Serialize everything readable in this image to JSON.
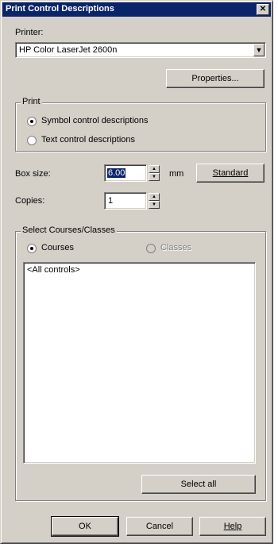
{
  "window": {
    "title": "Print Control Descriptions",
    "close_glyph": "✕"
  },
  "printer": {
    "label": "Printer:",
    "selected": "HP Color LaserJet 2600n",
    "properties_button": "Properties..."
  },
  "print_group": {
    "title": "Print",
    "options": [
      {
        "label": "Symbol control descriptions",
        "checked": true
      },
      {
        "label": "Text control descriptions",
        "checked": false
      }
    ]
  },
  "box_size": {
    "label": "Box size:",
    "value": "6.00",
    "unit": "mm",
    "standard_button": "Standard"
  },
  "copies": {
    "label": "Copies:",
    "value": "1"
  },
  "select_group": {
    "title": "Select Courses/Classes",
    "courses_label": "Courses",
    "classes_label": "Classes",
    "list_items": [
      "<All controls>"
    ],
    "select_all_button": "Select all"
  },
  "footer": {
    "ok": "OK",
    "cancel": "Cancel",
    "help": "Help"
  }
}
